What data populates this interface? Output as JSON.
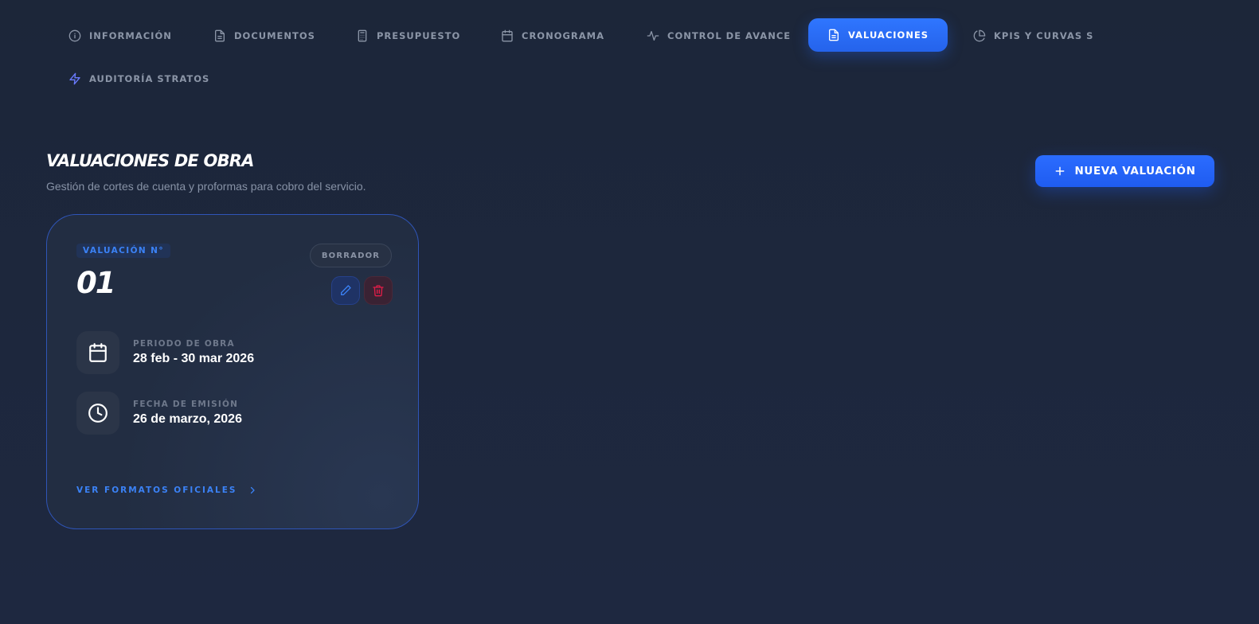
{
  "tabs": [
    {
      "label": "INFORMACIÓN",
      "icon": "info-icon"
    },
    {
      "label": "DOCUMENTOS",
      "icon": "document-icon"
    },
    {
      "label": "PRESUPUESTO",
      "icon": "calculator-icon"
    },
    {
      "label": "CRONOGRAMA",
      "icon": "calendar-icon"
    },
    {
      "label": "CONTROL DE AVANCE",
      "icon": "activity-icon"
    },
    {
      "label": "VALUACIONES",
      "icon": "document-icon",
      "active": true
    },
    {
      "label": "KPIS Y CURVAS S",
      "icon": "pie-chart-icon"
    },
    {
      "label": "AUDITORÍA STRATOS",
      "icon": "lightning-icon"
    }
  ],
  "header": {
    "title": "VALUACIONES DE OBRA",
    "subtitle": "Gestión de cortes de cuenta y proformas para cobro del servicio.",
    "new_button_label": "NUEVA VALUACIÓN"
  },
  "valuation_card": {
    "label": "VALUACIÓN N°",
    "number": "01",
    "status": "BORRADOR",
    "period_label": "PERIODO DE OBRA",
    "period_value": "28 feb - 30 mar 2026",
    "issue_label": "FECHA DE EMISIÓN",
    "issue_value": "26 de marzo, 2026",
    "link_label": "VER FORMATOS OFICIALES"
  },
  "colors": {
    "background": "#1c263a",
    "accent": "#2563eb",
    "accent_text": "#3b82f6",
    "danger": "#e11d48",
    "muted": "#8b95a7"
  }
}
